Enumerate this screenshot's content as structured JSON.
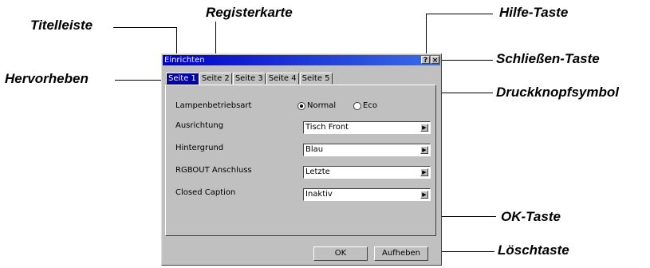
{
  "callouts": {
    "titelleiste": "Titelleiste",
    "registerkarte": "Registerkarte",
    "hilfe": "Hilfe-Taste",
    "schliessen": "Schließen-Taste",
    "hervorheben": "Hervorheben",
    "druckknopf": "Druckknopfsymbol",
    "ok": "OK-Taste",
    "loesch": "Löschtaste"
  },
  "dialog": {
    "title": "Einrichten",
    "help_glyph": "?",
    "close_glyph": "×",
    "tabs": [
      "Seite 1",
      "Seite 2",
      "Seite 3",
      "Seite 4",
      "Seite 5"
    ],
    "active_tab": 0,
    "rows": {
      "lamp": {
        "label": "Lampenbetriebsart",
        "option1": "Normal",
        "option2": "Eco",
        "selected": "Normal"
      },
      "ausrichtung": {
        "label": "Ausrichtung",
        "value": "Tisch Front"
      },
      "hintergrund": {
        "label": "Hintergrund",
        "value": "Blau"
      },
      "rgbout": {
        "label": "RGBOUT Anschluss",
        "value": "Letzte"
      },
      "caption": {
        "label": "Closed Caption",
        "value": "Inaktiv"
      }
    },
    "ok_label": "OK",
    "cancel_label": "Aufheben"
  },
  "colors": {
    "titlebar": "#0000c8",
    "active_tab": "#0000b0",
    "face": "#c0c0c0"
  }
}
